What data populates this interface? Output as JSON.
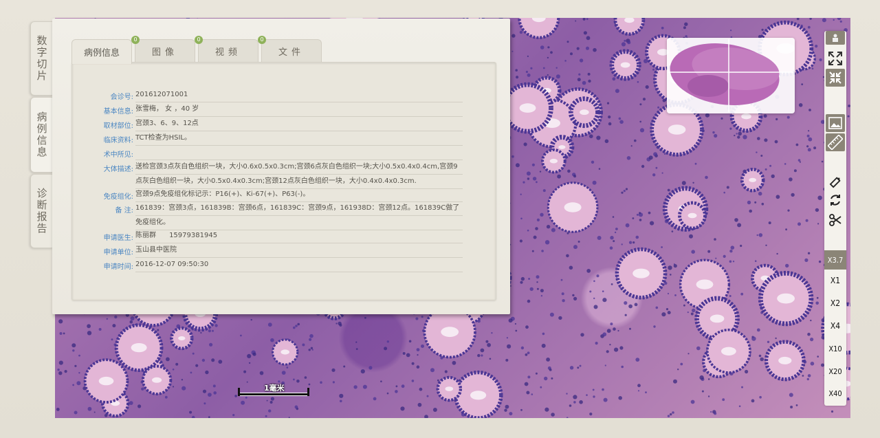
{
  "side_tabs": [
    {
      "label": "数字切片"
    },
    {
      "label": "病例信息"
    },
    {
      "label": "诊断报告"
    }
  ],
  "panel_tabs": [
    {
      "label": "病例信息",
      "badge": ""
    },
    {
      "label": "图像",
      "badge": "0"
    },
    {
      "label": "视频",
      "badge": "0"
    },
    {
      "label": "文件",
      "badge": "0"
    }
  ],
  "case": {
    "consult_no": {
      "label": "会诊号:",
      "value": "201612071001"
    },
    "basic_info": {
      "label": "基本信息:",
      "value": "张雪梅， 女 ，40 岁"
    },
    "sample_site": {
      "label": "取材部位:",
      "value": "宫颈3、6、9、12点"
    },
    "clinical": {
      "label": "临床资料:",
      "value": "TCT检查为HSIL。"
    },
    "intraop": {
      "label": "术中所见:",
      "value": ""
    },
    "gross": {
      "label": "大体描述:",
      "value": "送检宫颈3点灰白色组织一块，大小0.6x0.5x0.3cm;宫颈6点灰白色组织一块;大小0.5x0.4x0.4cm,宫颈9点灰白色组织一块，大小0.5x0.4x0.3cm;宫颈12点灰白色组织一块，大小0.4x0.4x0.3cm."
    },
    "ihc": {
      "label": "免疫组化:",
      "value": "宫颈9点免疫组化标记示：P16(+)、Ki-67(+)、P63(-)。"
    },
    "note": {
      "label": "备    注:",
      "value": "161839：宫颈3点，161839B：宫颈6点，161839C：宫颈9点，161938D：宫颈12点。161839C做了免疫组化。"
    },
    "doctor": {
      "label": "申请医生:",
      "value": "陈丽群      15979381945"
    },
    "hospital": {
      "label": "申请单位:",
      "value": "玉山县中医院"
    },
    "time": {
      "label": "申请时间:",
      "value": "2016-12-07 09:50:30"
    }
  },
  "scale_bar": {
    "label": "1毫米"
  },
  "toolbar": {
    "icons": [
      "home-icon",
      "fullscreen-icon",
      "exit-fullscreen-icon",
      "image-icon",
      "ruler-icon",
      "pencil-icon",
      "rotate-icon",
      "scissors-icon"
    ],
    "zoom_levels": [
      "X3.7",
      "X1",
      "X2",
      "X4",
      "X10",
      "X20",
      "X40"
    ],
    "active_zoom": "X3.7"
  },
  "colors": {
    "accent_blue": "#4a86c2",
    "badge_green": "#8fb25a",
    "toolbar_dark": "#8b8577"
  }
}
